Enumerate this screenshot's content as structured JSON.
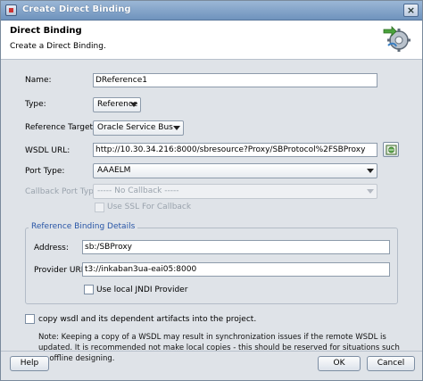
{
  "window": {
    "title": "Create Direct Binding"
  },
  "header": {
    "title": "Direct Binding",
    "subtitle": "Create a Direct Binding."
  },
  "form": {
    "name": {
      "label": "Name:",
      "value": "DReference1"
    },
    "type": {
      "label": "Type:",
      "value": "Reference"
    },
    "reference_target": {
      "label": "Reference Target:",
      "value": "Oracle Service Bus"
    },
    "wsdl_url": {
      "label": "WSDL URL:",
      "value": "http://10.30.34.216:8000/sbresource?Proxy/SBProtocol%2FSBProxy"
    },
    "port_type": {
      "label": "Port Type:",
      "value": "AAAELM"
    },
    "callback_port_type": {
      "label": "Callback Port Type:",
      "value": "----- No Callback -----"
    },
    "use_ssl_for_callback": {
      "label": "Use SSL For Callback"
    }
  },
  "reference_binding": {
    "group_title": "Reference Binding Details",
    "address": {
      "label": "Address:",
      "value": "sb:/SBProxy"
    },
    "provider_url": {
      "label": "Provider URL:",
      "value": "t3://inkaban3ua-eai05:8000"
    },
    "use_local_jndi": {
      "label": "Use local JNDI Provider"
    }
  },
  "copy_wsdl": {
    "label": "copy wsdl and its dependent artifacts into the project."
  },
  "note": "Note: Keeping a copy of a WSDL may result in synchronization issues if the remote WSDL is updated. It is recommended not make local copies - this should be reserved for situations such as offline designing.",
  "buttons": {
    "help": "Help",
    "ok": "OK",
    "cancel": "Cancel"
  },
  "colors": {
    "title_bar": "#7f9fc6",
    "group_title": "#2855a6",
    "dialog_bg": "#dfe3e8"
  },
  "icons": {
    "window": "app-icon",
    "header": "wizard-gear-icon",
    "browse": "browse-wsdl-icon",
    "close": "close-icon"
  }
}
